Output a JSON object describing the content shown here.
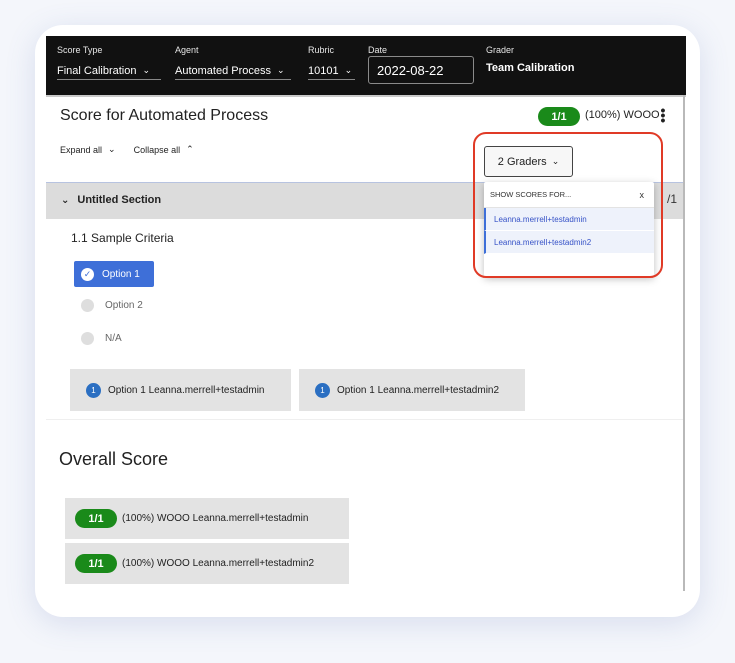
{
  "topbar": {
    "score_type": {
      "label": "Score Type",
      "value": "Final Calibration"
    },
    "agent": {
      "label": "Agent",
      "value": "Automated Process"
    },
    "rubric": {
      "label": "Rubric",
      "value": "10101"
    },
    "date": {
      "label": "Date",
      "value": "2022-08-22"
    },
    "grader": {
      "label": "Grader",
      "value": "Team Calibration"
    }
  },
  "score_header": {
    "title": "Score for Automated Process",
    "score_pill": "1/1",
    "score_text": "(100%) WOOO",
    "expand_all": "Expand all",
    "collapse_all": "Collapse all",
    "graders_button": "2 Graders"
  },
  "section": {
    "title": "Untitled Section",
    "right_text": "/1",
    "criteria": "1.1  Sample Criteria",
    "options": [
      "Option 1",
      "Option 2",
      "N/A"
    ],
    "selected_option": "Option 1"
  },
  "grader_responses": [
    {
      "badge": "1",
      "text": "Option 1 Leanna.merrell+testadmin"
    },
    {
      "badge": "1",
      "text": "Option 1 Leanna.merrell+testadmin2"
    }
  ],
  "overall": {
    "title": "Overall Score",
    "rows": [
      {
        "pill": "1/1",
        "text": "(100%) WOOO Leanna.merrell+testadmin"
      },
      {
        "pill": "1/1",
        "text": "(100%) WOOO Leanna.merrell+testadmin2"
      }
    ]
  },
  "dropdown": {
    "header": "SHOW SCORES FOR...",
    "close": "x",
    "items": [
      "Leanna.merrell+testadmin",
      "Leanna.merrell+testadmin2"
    ]
  },
  "colors": {
    "accent_blue": "#3e6fd8",
    "score_green": "#1a8a1a",
    "highlight_red": "#e03a26",
    "topbar_bg": "#111111"
  },
  "icons": {
    "chevron": "chevron-down-icon",
    "check": "check-icon",
    "kebab": "kebab-menu-icon"
  }
}
